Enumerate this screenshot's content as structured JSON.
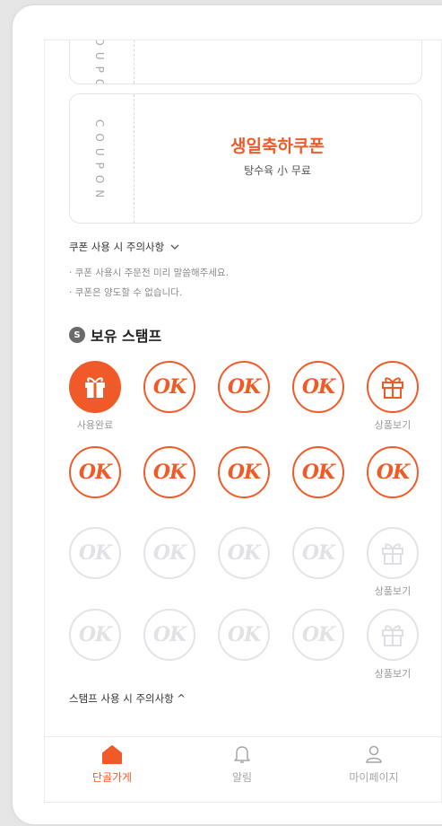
{
  "coupons": [
    {
      "vertical": "COUPON",
      "title": "",
      "subtitle": ""
    },
    {
      "vertical": "COUPON",
      "title": "생일축하쿠폰",
      "subtitle": "탕수육 小 무료"
    }
  ],
  "coupon_notice": {
    "heading": "쿠폰 사용 시 주의사항",
    "lines": [
      "· 쿠폰 사용시 주문전 미리 말씀해주세요.",
      "· 쿠폰은 양도할 수 없습니다."
    ]
  },
  "stamps": {
    "badge": "S",
    "title": "보유 스탬프",
    "stamp_text": "OK",
    "used_label": "사용완료",
    "view_label": "상품보기",
    "notice": "스탬프 사용 시 주의사항 ^"
  },
  "nav": {
    "home": "단골가게",
    "alert": "알림",
    "mypage": "마이페이지"
  },
  "colors": {
    "accent": "#f05a28",
    "inactive": "#e3e3e8"
  }
}
